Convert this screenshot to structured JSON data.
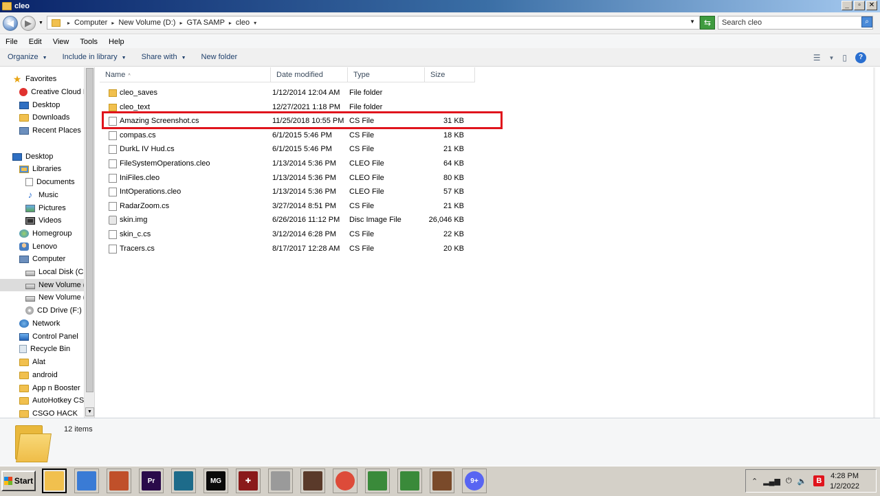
{
  "window": {
    "title": "cleo",
    "buttons": [
      "_",
      "▫",
      "✕"
    ]
  },
  "address": {
    "crumbs": [
      "Computer",
      "New Volume (D:)",
      "GTA SAMP",
      "cleo"
    ],
    "search_placeholder": "Search cleo"
  },
  "menubar": [
    "File",
    "Edit",
    "View",
    "Tools",
    "Help"
  ],
  "commandbar": {
    "organize": "Organize",
    "include": "Include in library",
    "share": "Share with",
    "newfolder": "New folder"
  },
  "nav": {
    "favorites": "Favorites",
    "creative_cloud": "Creative Cloud F",
    "desktop_fav": "Desktop",
    "downloads": "Downloads",
    "recent": "Recent Places",
    "desktop": "Desktop",
    "libraries": "Libraries",
    "documents": "Documents",
    "music": "Music",
    "pictures": "Pictures",
    "videos": "Videos",
    "homegroup": "Homegroup",
    "lenovo": "Lenovo",
    "computer": "Computer",
    "local_disk": "Local Disk (C:)",
    "new_volume_d": "New Volume (D",
    "new_volume_e": "New Volume (E",
    "cd_drive": "CD Drive (F:)",
    "network": "Network",
    "control_panel": "Control Panel",
    "recycle_bin": "Recycle Bin",
    "alat": "Alat",
    "android": "android",
    "app_booster": "App n Booster",
    "autohotkey": "AutoHotkey CSG",
    "csgo_hack": "CSGO HACK"
  },
  "columns": {
    "name": "Name",
    "date": "Date modified",
    "type": "Type",
    "size": "Size"
  },
  "files": [
    {
      "name": "cleo_saves",
      "date": "1/12/2014 12:04 AM",
      "type": "File folder",
      "size": "",
      "icon": "folder-icon"
    },
    {
      "name": "cleo_text",
      "date": "12/27/2021 1:18 PM",
      "type": "File folder",
      "size": "",
      "icon": "folder-icon"
    },
    {
      "name": "Amazing Screenshot.cs",
      "date": "11/25/2018 10:55 PM",
      "type": "CS File",
      "size": "31 KB",
      "icon": "file-icon"
    },
    {
      "name": "compas.cs",
      "date": "6/1/2015 5:46 PM",
      "type": "CS File",
      "size": "18 KB",
      "icon": "file-icon"
    },
    {
      "name": "DurkL IV Hud.cs",
      "date": "6/1/2015 5:46 PM",
      "type": "CS File",
      "size": "21 KB",
      "icon": "file-icon"
    },
    {
      "name": "FileSystemOperations.cleo",
      "date": "1/13/2014 5:36 PM",
      "type": "CLEO File",
      "size": "64 KB",
      "icon": "file-icon"
    },
    {
      "name": "IniFiles.cleo",
      "date": "1/13/2014 5:36 PM",
      "type": "CLEO File",
      "size": "80 KB",
      "icon": "file-icon"
    },
    {
      "name": "IntOperations.cleo",
      "date": "1/13/2014 5:36 PM",
      "type": "CLEO File",
      "size": "57 KB",
      "icon": "file-icon"
    },
    {
      "name": "RadarZoom.cs",
      "date": "3/27/2014 8:51 PM",
      "type": "CS File",
      "size": "21 KB",
      "icon": "file-icon"
    },
    {
      "name": "skin.img",
      "date": "6/26/2016 11:12 PM",
      "type": "Disc Image File",
      "size": "26,046 KB",
      "icon": "disc-image-icon"
    },
    {
      "name": "skin_c.cs",
      "date": "3/12/2014 6:28 PM",
      "type": "CS File",
      "size": "22 KB",
      "icon": "file-icon"
    },
    {
      "name": "Tracers.cs",
      "date": "8/17/2017 12:28 AM",
      "type": "CS File",
      "size": "20 KB",
      "icon": "file-icon"
    }
  ],
  "details": {
    "item_count": "12 items"
  },
  "taskbar": {
    "start": "Start",
    "apps": [
      {
        "name": "explorer",
        "label": "",
        "color": "#f1c04e"
      },
      {
        "name": "control-panel",
        "label": "",
        "color": "#3a7bd5"
      },
      {
        "name": "game-1",
        "label": "",
        "color": "#c0502a"
      },
      {
        "name": "premiere",
        "label": "Pr",
        "color": "#2a0a4a"
      },
      {
        "name": "app-blue",
        "label": "",
        "color": "#1d6b8a"
      },
      {
        "name": "mg",
        "label": "MG",
        "color": "#0a0a0a"
      },
      {
        "name": "cross",
        "label": "✚",
        "color": "#8a1a1a"
      },
      {
        "name": "keyboard",
        "label": "",
        "color": "#9a9a9a"
      },
      {
        "name": "game-2",
        "label": "",
        "color": "#5a3a2a"
      },
      {
        "name": "chrome",
        "label": "",
        "color": "#dd4b39"
      },
      {
        "name": "monitor-1",
        "label": "",
        "color": "#3a8a3a"
      },
      {
        "name": "monitor-2",
        "label": "",
        "color": "#3a8a3a"
      },
      {
        "name": "game-3",
        "label": "",
        "color": "#7a4a2a"
      },
      {
        "name": "discord",
        "label": "9+",
        "color": "#5865f2"
      }
    ],
    "tray_badge": "B",
    "time": "4:28 PM",
    "date": "1/2/2022"
  }
}
